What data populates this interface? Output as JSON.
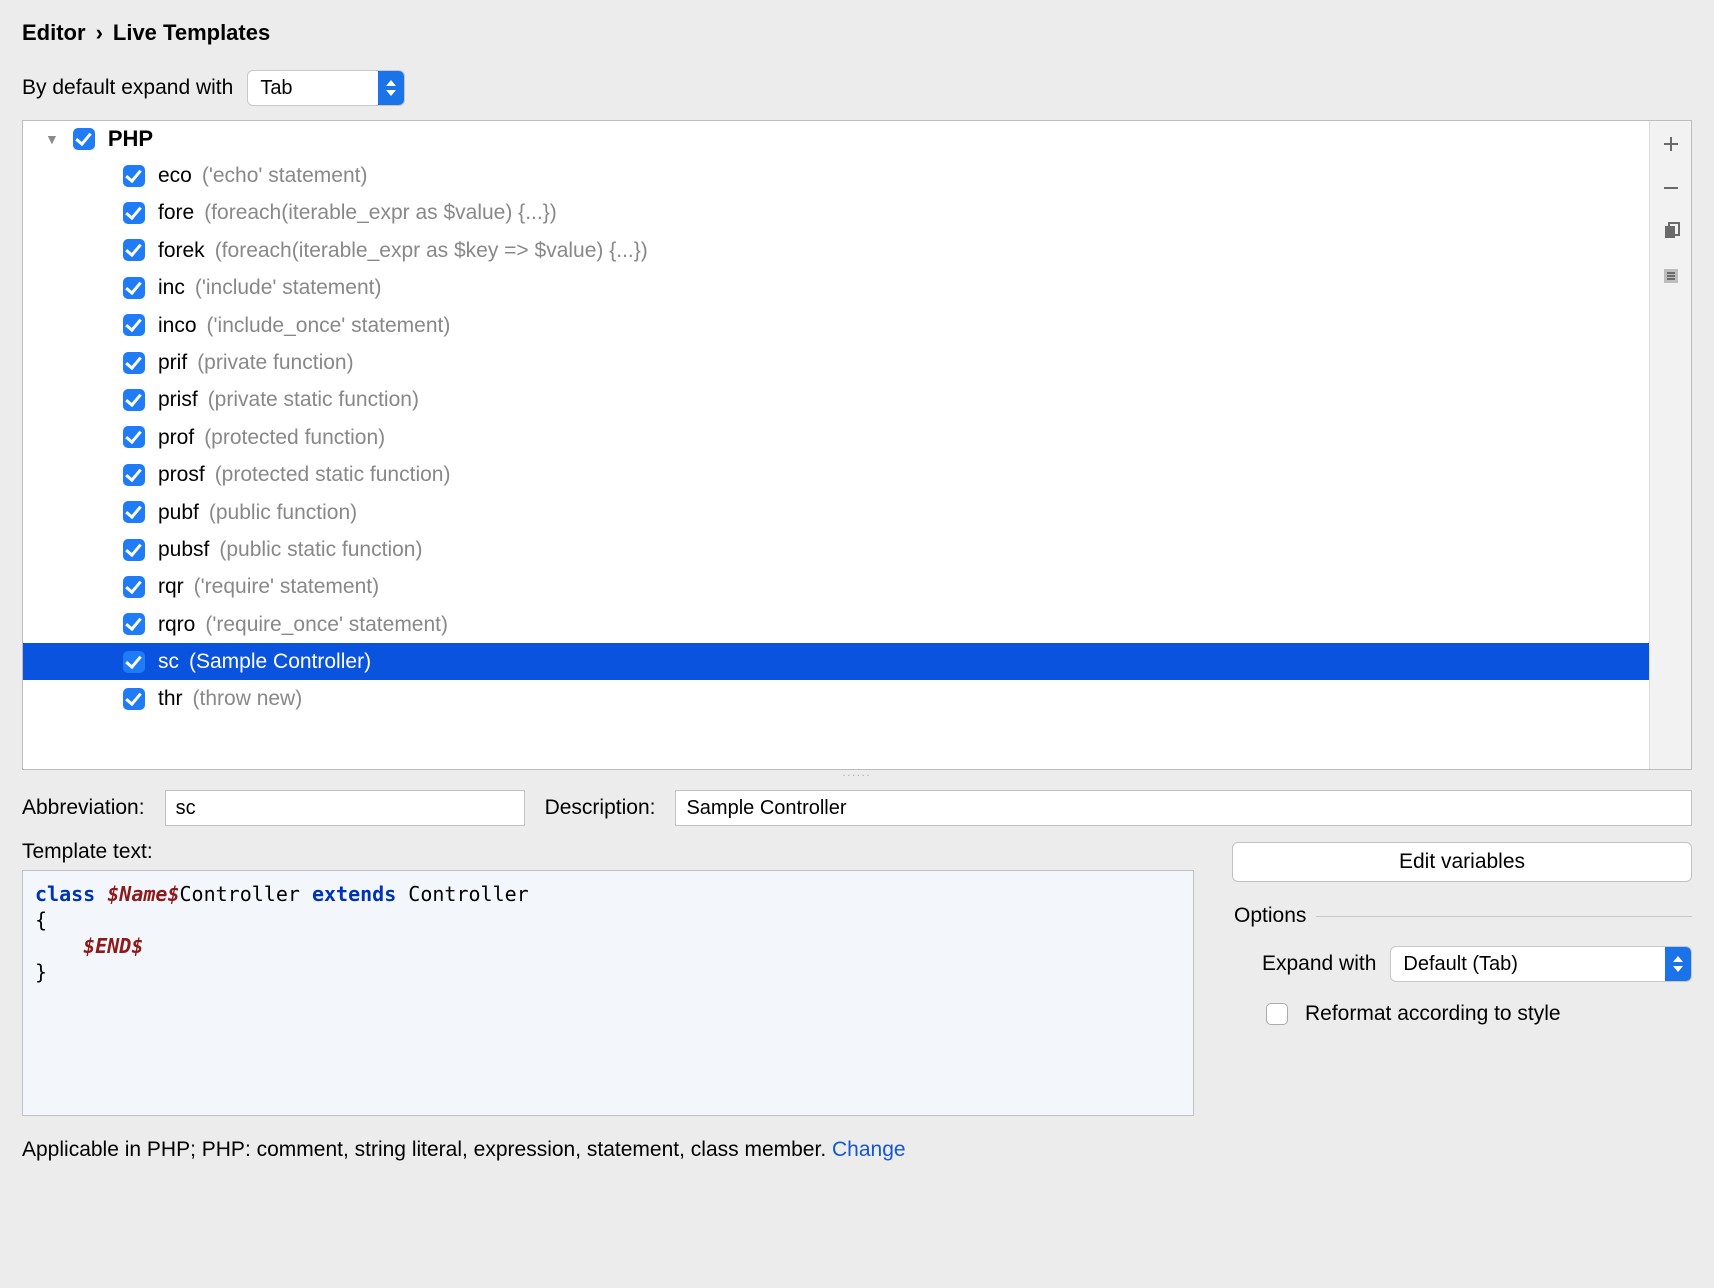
{
  "breadcrumb": {
    "item0": "Editor",
    "item1": "Live Templates"
  },
  "expand_default_label": "By default expand with",
  "expand_default_value": "Tab",
  "group": {
    "name": "PHP",
    "checked": true
  },
  "items": [
    {
      "abbr": "eco",
      "desc": "('echo' statement)",
      "checked": true,
      "selected": false
    },
    {
      "abbr": "fore",
      "desc": "(foreach(iterable_expr as $value) {...})",
      "checked": true,
      "selected": false
    },
    {
      "abbr": "forek",
      "desc": "(foreach(iterable_expr as $key => $value) {...})",
      "checked": true,
      "selected": false
    },
    {
      "abbr": "inc",
      "desc": "('include' statement)",
      "checked": true,
      "selected": false
    },
    {
      "abbr": "inco",
      "desc": "('include_once' statement)",
      "checked": true,
      "selected": false
    },
    {
      "abbr": "prif",
      "desc": "(private function)",
      "checked": true,
      "selected": false
    },
    {
      "abbr": "prisf",
      "desc": "(private static function)",
      "checked": true,
      "selected": false
    },
    {
      "abbr": "prof",
      "desc": "(protected function)",
      "checked": true,
      "selected": false
    },
    {
      "abbr": "prosf",
      "desc": "(protected static function)",
      "checked": true,
      "selected": false
    },
    {
      "abbr": "pubf",
      "desc": "(public function)",
      "checked": true,
      "selected": false
    },
    {
      "abbr": "pubsf",
      "desc": "(public static function)",
      "checked": true,
      "selected": false
    },
    {
      "abbr": "rqr",
      "desc": "('require' statement)",
      "checked": true,
      "selected": false
    },
    {
      "abbr": "rqro",
      "desc": "('require_once' statement)",
      "checked": true,
      "selected": false
    },
    {
      "abbr": "sc",
      "desc": "(Sample Controller)",
      "checked": true,
      "selected": true
    },
    {
      "abbr": "thr",
      "desc": "(throw new)",
      "checked": true,
      "selected": false
    }
  ],
  "fields": {
    "abbr_label": "Abbreviation:",
    "abbr_value": "sc",
    "desc_label": "Description:",
    "desc_value": "Sample Controller",
    "template_label": "Template text:"
  },
  "template_code": {
    "kw_class": "class ",
    "var_name": "$Name$",
    "after_name": "Controller ",
    "kw_extends": "extends ",
    "after_extends": "Controller",
    "brace_open": "{",
    "indent_end": "    ",
    "var_end": "$END$",
    "brace_close": "}"
  },
  "buttons": {
    "edit_variables": "Edit variables"
  },
  "options": {
    "legend": "Options",
    "expand_with_label": "Expand with",
    "expand_with_value": "Default (Tab)",
    "reformat_label": "Reformat according to style",
    "reformat_checked": false
  },
  "applicable": {
    "text": "Applicable in PHP; PHP: comment, string literal, expression, statement, class member. ",
    "link": "Change"
  }
}
